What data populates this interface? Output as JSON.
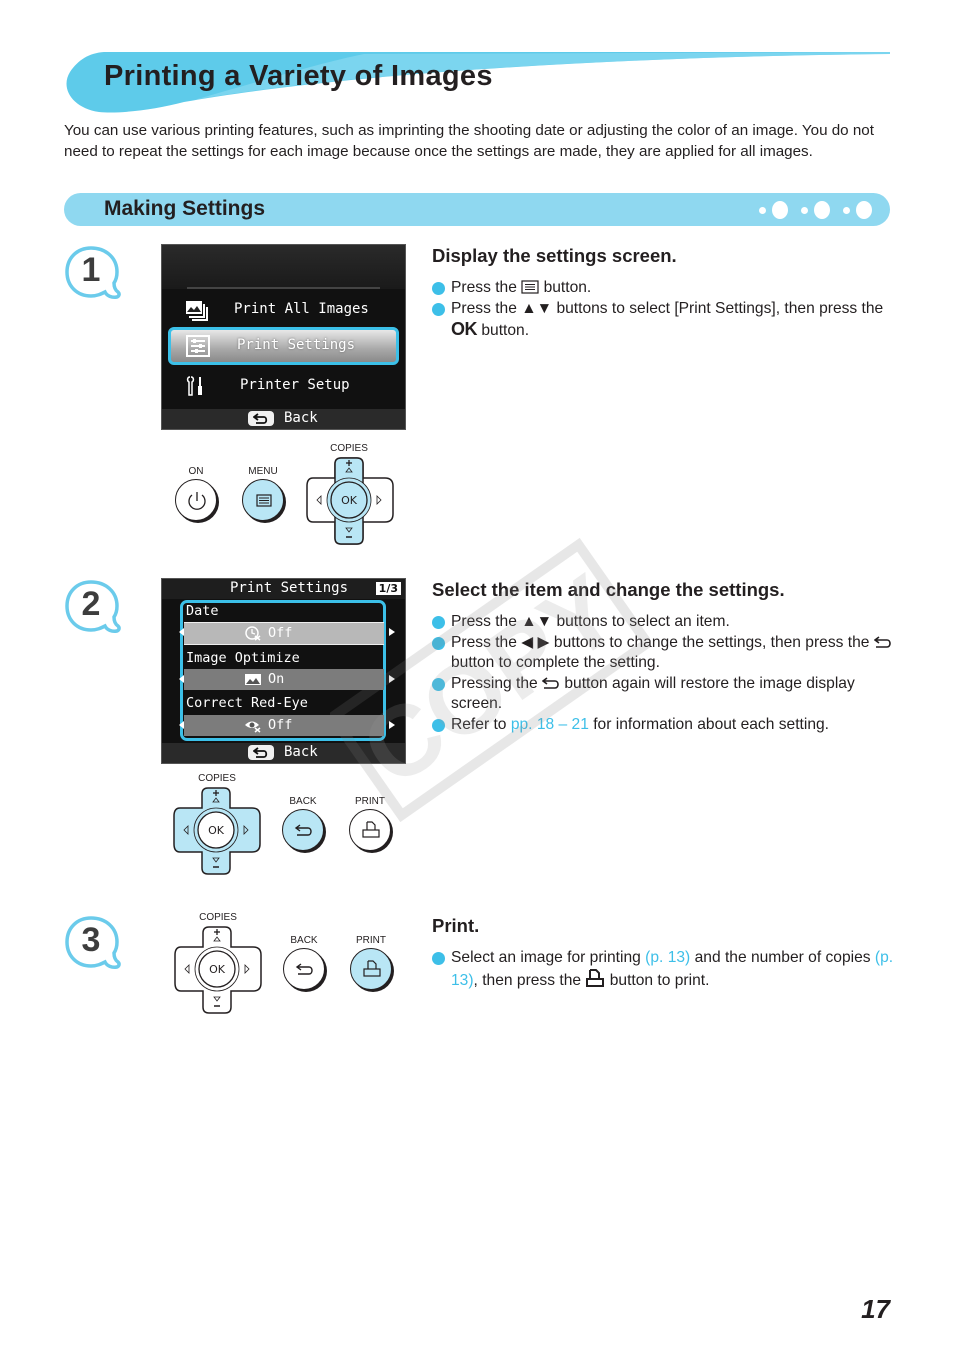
{
  "header": {
    "title": "Printing a Variety of Images",
    "intro": "You can use various printing features, such as imprinting the shooting date or adjusting the color of an image. You do not need to repeat the settings for each image because once the settings are made, they are applied for all images.",
    "banner_color": "#5ecbea"
  },
  "section": {
    "title": "Making Settings",
    "bar_color": "#8fd8f0"
  },
  "watermark": {
    "text": "COPY"
  },
  "steps": [
    {
      "number": "1",
      "heading": "Display the settings screen.",
      "bullets": [
        {
          "pre": "Press the",
          "icon": "menu-icon",
          "post": "button."
        },
        {
          "pre": "Press the",
          "icon": "up-down-arrows-icon",
          "mid": "buttons to select [Print Settings], then press the",
          "icon2": "ok-glyph",
          "ok": "OK",
          "post": "button."
        }
      ],
      "screen": {
        "items": [
          {
            "icon": "print-all-images-icon",
            "label": "Print All Images",
            "selected": false
          },
          {
            "icon": "print-settings-icon",
            "label": "Print Settings",
            "selected": true
          },
          {
            "icon": "printer-setup-icon",
            "label": "Printer Setup",
            "selected": false
          }
        ],
        "back_label": "Back"
      },
      "buttons": {
        "on_label": "ON",
        "menu_label": "MENU",
        "copies_label": "COPIES",
        "ok_label": "OK"
      }
    },
    {
      "number": "2",
      "heading": "Select the item and change the settings.",
      "bullets": [
        {
          "pre": "Press the",
          "icon": "up-down-arrows-icon",
          "post": "buttons to select an item."
        },
        {
          "pre": "Press the",
          "icon": "left-right-arrows-icon",
          "mid": "buttons to change the settings, then press the",
          "icon2": "back-icon",
          "post": "button to complete the setting."
        },
        {
          "pre": "Pressing the",
          "icon": "back-icon",
          "post": "button again will restore the image display screen."
        },
        {
          "pre": "Refer to",
          "link": "pp. 18 – 21",
          "post": "for information about each setting."
        }
      ],
      "screen": {
        "title": "Print Settings",
        "page": "1/3",
        "settings": [
          {
            "label": "Date",
            "icon": "date-off-icon",
            "value": "Off",
            "selected": true
          },
          {
            "label": "Image Optimize",
            "icon": "image-optimize-icon",
            "value": "On",
            "selected": false
          },
          {
            "label": "Correct Red-Eye",
            "icon": "red-eye-off-icon",
            "value": "Off",
            "selected": false
          }
        ],
        "back_label": "Back"
      },
      "buttons": {
        "copies_label": "COPIES",
        "ok_label": "OK",
        "back_label": "BACK",
        "print_label": "PRINT"
      }
    },
    {
      "number": "3",
      "heading": "Print.",
      "bullets": [
        {
          "pre": "Select an image for printing",
          "link1": "(p. 13)",
          "mid": "and the number of copies",
          "link2": "(p. 13)",
          "mid2": ", then press the",
          "icon": "print-icon",
          "post": "button to print."
        }
      ],
      "buttons": {
        "copies_label": "COPIES",
        "ok_label": "OK",
        "back_label": "BACK",
        "print_label": "PRINT"
      }
    }
  ],
  "footer": {
    "page_number": "17"
  },
  "colors": {
    "accent": "#3dbfe8",
    "button_highlight": "#b9e6f5",
    "text": "#231f20"
  }
}
